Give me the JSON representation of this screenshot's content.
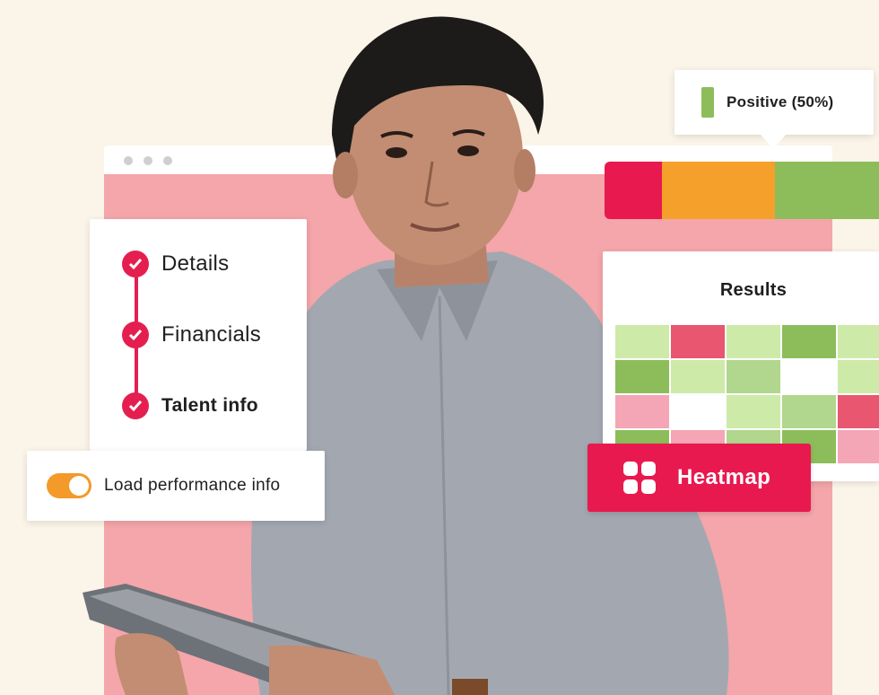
{
  "steps": [
    {
      "label": "Details",
      "bold": false
    },
    {
      "label": "Financials",
      "bold": false
    },
    {
      "label": "Talent info",
      "bold": true
    }
  ],
  "toggle": {
    "label": "Load performance info",
    "on": true
  },
  "tooltip": {
    "label": "Positive (50%)",
    "color": "#8dbd5a"
  },
  "sentiment": {
    "segments": [
      {
        "color": "#e8194f",
        "share": 0.21
      },
      {
        "color": "#f5a02a",
        "share": 0.41
      },
      {
        "color": "#8dbd5a",
        "share": 0.38
      }
    ]
  },
  "results": {
    "title": "Results",
    "heatmap_cells": [
      [
        "#cdeaa8",
        "#e8566f",
        "#cdeaa8",
        "#8dbd5a",
        "#cdeaa8"
      ],
      [
        "#8dbd5a",
        "#cdeaa8",
        "#b1d68d",
        "#ffffff",
        "#cdeaa8"
      ],
      [
        "#f4a6b6",
        "#ffffff",
        "#cdeaa8",
        "#b1d68d",
        "#e8566f"
      ],
      [
        "#8dbd5a",
        "#f4a6b6",
        "#b1d68d",
        "#8dbd5a",
        "#f4a6b6"
      ]
    ]
  },
  "heatmap_button": {
    "label": "Heatmap",
    "icon": "grid-icon"
  },
  "colors": {
    "accent": "#e8194f",
    "background": "#fbf4e8",
    "window_body": "#f4a6aa",
    "toggle_on": "#f39a2a"
  }
}
